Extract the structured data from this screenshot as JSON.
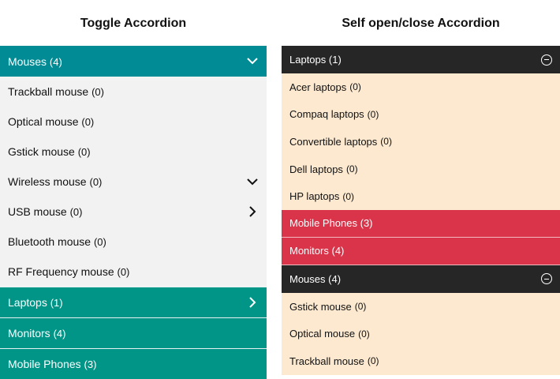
{
  "titles": {
    "left": "Toggle Accordion",
    "right": "Self open/close Accordion"
  },
  "left_accordion": {
    "open_section": {
      "label": "Mouses",
      "count": "(4)"
    },
    "items": [
      {
        "label": "Trackball mouse",
        "count": "(0)",
        "icon": ""
      },
      {
        "label": "Optical mouse",
        "count": "(0)",
        "icon": ""
      },
      {
        "label": "Gstick mouse",
        "count": "(0)",
        "icon": ""
      },
      {
        "label": "Wireless mouse",
        "count": "(0)",
        "icon": "chevron-down"
      },
      {
        "label": "USB mouse",
        "count": "(0)",
        "icon": "chevron-right"
      },
      {
        "label": "Bluetooth mouse",
        "count": "(0)",
        "icon": ""
      },
      {
        "label": "RF Frequency mouse",
        "count": "(0)",
        "icon": ""
      }
    ],
    "closed_sections": [
      {
        "label": "Laptops",
        "count": "(1)",
        "icon": "chevron-right"
      },
      {
        "label": "Monitors",
        "count": "(4)",
        "icon": ""
      },
      {
        "label": "Mobile Phones",
        "count": "(3)",
        "icon": ""
      }
    ],
    "colors": {
      "open_header": "#008b95",
      "closed_header": "#009587",
      "body": "#f2f2f2"
    }
  },
  "right_accordion": {
    "laptops": {
      "label": "Laptops",
      "count": "(1)",
      "items": [
        {
          "label": "Acer laptops",
          "count": "(0)"
        },
        {
          "label": "Compaq laptops",
          "count": "(0)"
        },
        {
          "label": "Convertible laptops",
          "count": "(0)"
        },
        {
          "label": "Dell laptops",
          "count": "(0)"
        },
        {
          "label": "HP laptops",
          "count": "(0)"
        }
      ]
    },
    "mobile_phones": {
      "label": "Mobile Phones",
      "count": "(3)"
    },
    "monitors": {
      "label": "Monitors",
      "count": "(4)"
    },
    "mouses": {
      "label": "Mouses",
      "count": "(4)",
      "items": [
        {
          "label": "Gstick mouse",
          "count": "(0)"
        },
        {
          "label": "Optical mouse",
          "count": "(0)"
        },
        {
          "label": "Trackball mouse",
          "count": "(0)"
        }
      ]
    },
    "colors": {
      "dark_header": "#262626",
      "red_header": "#d9344a",
      "body": "#fde9d0"
    }
  }
}
